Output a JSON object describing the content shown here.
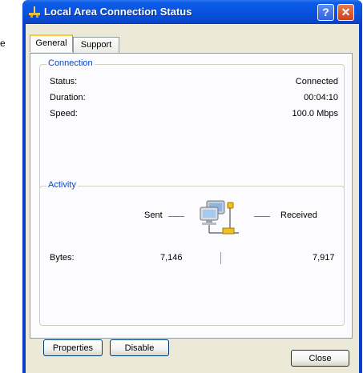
{
  "window": {
    "title": "Local Area Connection Status",
    "help_label": "?",
    "close_symbol": "✕"
  },
  "side_fragment": "e",
  "tabs": [
    {
      "label": "General",
      "active": true
    },
    {
      "label": "Support",
      "active": false
    }
  ],
  "connection": {
    "group_label": "Connection",
    "rows": [
      {
        "key": "Status:",
        "value": "Connected"
      },
      {
        "key": "Duration:",
        "value": "00:04:10"
      },
      {
        "key": "Speed:",
        "value": "100.0 Mbps"
      }
    ]
  },
  "activity": {
    "group_label": "Activity",
    "sent_label": "Sent",
    "received_label": "Received",
    "bytes_label": "Bytes:",
    "bytes_sent": "7,146",
    "bytes_received": "7,917",
    "icon": "network-computers-icon"
  },
  "buttons": {
    "properties": "Properties",
    "disable": "Disable",
    "close": "Close"
  },
  "colors": {
    "titlebar": "#0853e0",
    "accent_label": "#0046d5",
    "dialog_bg": "#ece9d8"
  }
}
